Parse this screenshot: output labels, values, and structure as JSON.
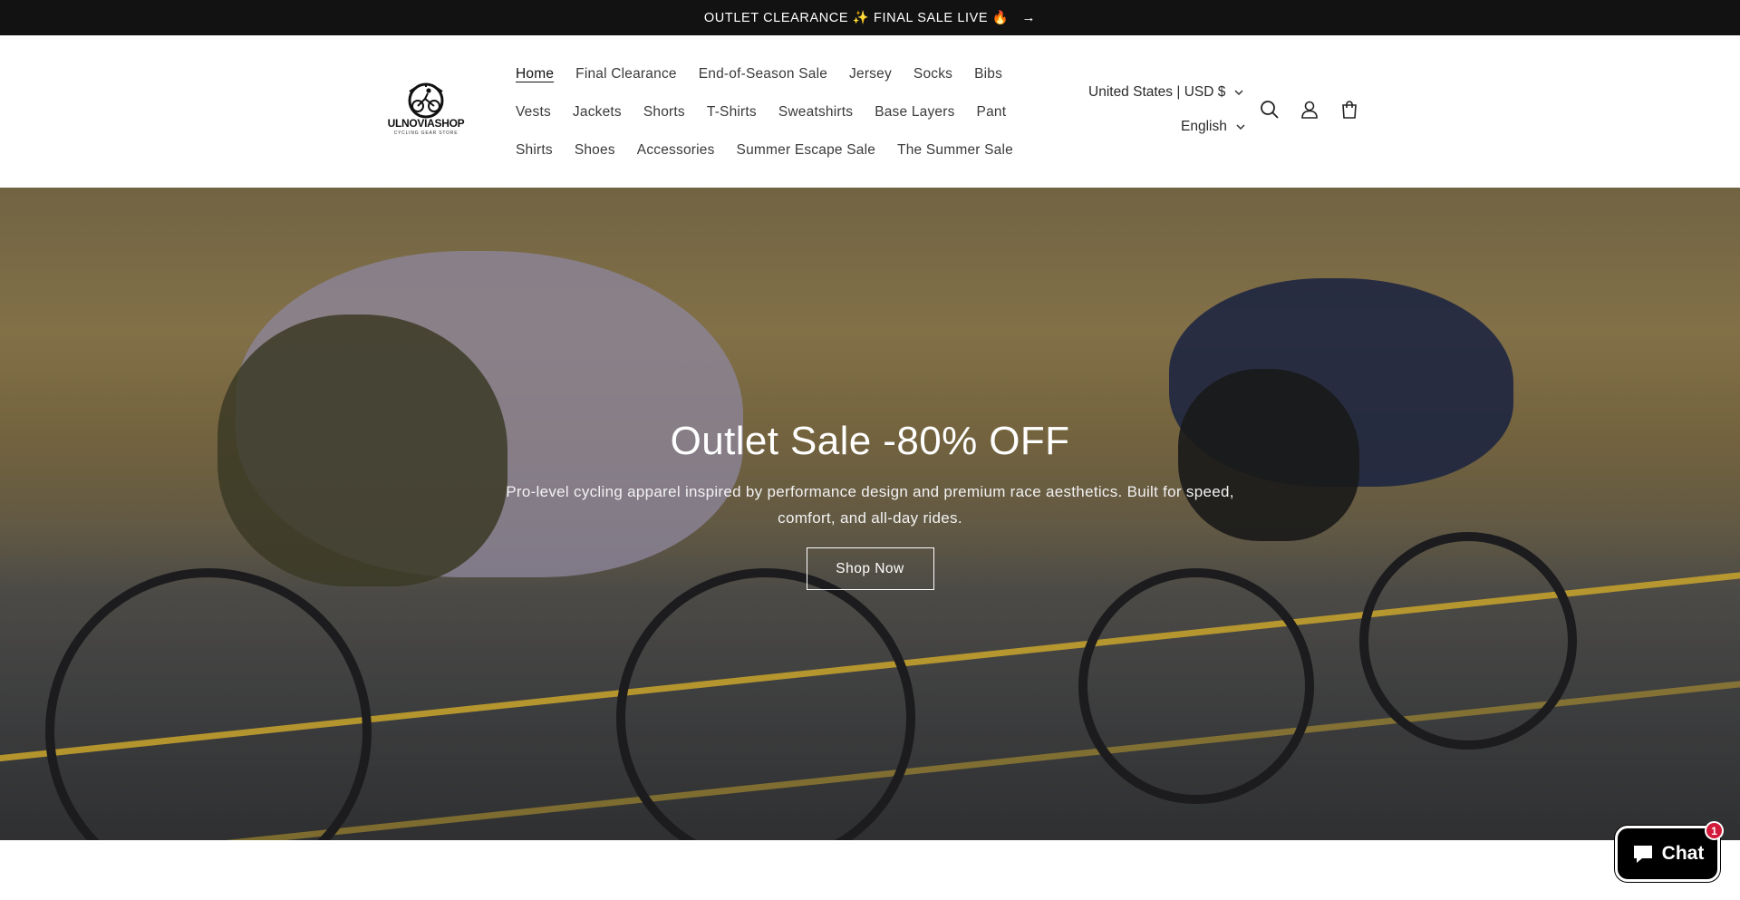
{
  "announcement": {
    "text": "OUTLET CLEARANCE ✨ FINAL SALE LIVE 🔥",
    "arrow": "→"
  },
  "header": {
    "logo": {
      "brand": "ULNOVIASHOP",
      "tagline": "CYCLING GEAR STORE"
    },
    "nav_rows": [
      [
        "Home",
        "Final Clearance",
        "End-of-Season Sale",
        "Jersey",
        "Socks",
        "Bibs"
      ],
      [
        "Vests",
        "Jackets",
        "Shorts",
        "T-Shirts",
        "Sweatshirts",
        "Base Layers",
        "Pant"
      ],
      [
        "Shirts",
        "Shoes",
        "Accessories",
        "Summer Escape Sale",
        "The Summer Sale"
      ]
    ],
    "active_nav": "Home",
    "country_label": "United States | USD $",
    "language_label": "English",
    "icons": [
      "search-icon",
      "account-icon",
      "cart-icon"
    ]
  },
  "hero": {
    "title": "Outlet Sale -80% OFF",
    "subtitle": "Pro-level cycling apparel inspired by performance design and premium race aesthetics. Built for speed, comfort, and all-day rides.",
    "button_label": "Shop Now"
  },
  "chat": {
    "label": "Chat",
    "badge_count": "1"
  },
  "colors": {
    "announcement_bg": "#121212",
    "badge": "#d21b3a",
    "road_line": "#c9a52b"
  }
}
